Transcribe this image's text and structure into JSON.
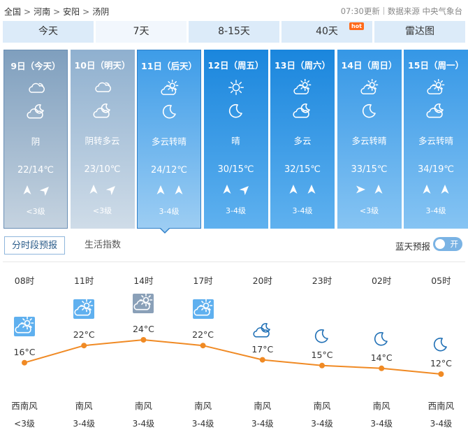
{
  "breadcrumb": [
    "全国",
    "河南",
    "安阳",
    "汤阴"
  ],
  "breadcrumb_sep": ">",
  "meta": {
    "update_time": "07:30更新",
    "source": "数据来源 中央气象台"
  },
  "tabs": [
    {
      "label": "今天"
    },
    {
      "label": "7天"
    },
    {
      "label": "8-15天"
    },
    {
      "label": "40天",
      "badge": "hot"
    },
    {
      "label": "雷达图"
    }
  ],
  "days": [
    {
      "date": "9日（今天）",
      "day_icon": "cloudy-icon",
      "night_icon": "cloudy-night-icon",
      "desc": "阴",
      "temp": "22/14℃",
      "winds": [
        "north",
        "northeast"
      ],
      "level": "<3级",
      "style": "past"
    },
    {
      "date": "10日（明天）",
      "day_icon": "cloudy-icon",
      "night_icon": "partly-cloudy-night-icon",
      "desc": "阴转多云",
      "temp": "23/10℃",
      "winds": [
        "north",
        "northeast"
      ],
      "level": "<3级",
      "style": "past2"
    },
    {
      "date": "11日（后天）",
      "day_icon": "partly-cloudy-day-icon",
      "night_icon": "moon-icon",
      "desc": "多云转晴",
      "temp": "24/12℃",
      "winds": [
        "north",
        "north"
      ],
      "level": "3-4级",
      "style": "sel"
    },
    {
      "date": "12日（周五）",
      "day_icon": "sun-icon",
      "night_icon": "moon-icon",
      "desc": "晴",
      "temp": "30/15℃",
      "winds": [
        "north",
        "northeast"
      ],
      "level": "3-4级",
      "style": "fut"
    },
    {
      "date": "13日（周六）",
      "day_icon": "partly-cloudy-day-icon",
      "night_icon": "partly-cloudy-night-icon",
      "desc": "多云",
      "temp": "32/15℃",
      "winds": [
        "north",
        "north"
      ],
      "level": "3-4级",
      "style": "fut"
    },
    {
      "date": "14日（周日）",
      "day_icon": "partly-cloudy-day-icon",
      "night_icon": "moon-icon",
      "desc": "多云转晴",
      "temp": "33/15℃",
      "winds": [
        "east",
        "north"
      ],
      "level": "<3级",
      "style": "fut2"
    },
    {
      "date": "15日（周一）",
      "day_icon": "partly-cloudy-day-icon",
      "night_icon": "partly-cloudy-night-icon",
      "desc": "多云转晴",
      "temp": "34/19℃",
      "winds": [
        "north",
        "north"
      ],
      "level": "3-4级",
      "style": "fut2"
    }
  ],
  "subtabs": {
    "active": "分时段预报",
    "other": "生活指数"
  },
  "blue_sky": {
    "label": "蓝天预报",
    "toggle": "开"
  },
  "hourly": [
    {
      "time": "08时",
      "icon": "partly-cloudy-day-icon",
      "temp": "16°C",
      "wind": "西南风",
      "level": "<3级"
    },
    {
      "time": "11时",
      "icon": "partly-cloudy-day-icon",
      "temp": "22°C",
      "wind": "南风",
      "level": "3-4级"
    },
    {
      "time": "14时",
      "icon": "partly-cloudy-day-gray-icon",
      "temp": "24°C",
      "wind": "南风",
      "level": "3-4级"
    },
    {
      "time": "17时",
      "icon": "partly-cloudy-day-icon",
      "temp": "22°C",
      "wind": "南风",
      "level": "3-4级"
    },
    {
      "time": "20时",
      "icon": "cloudy-night-icon",
      "temp": "17°C",
      "wind": "南风",
      "level": "3-4级"
    },
    {
      "time": "23时",
      "icon": "moon-icon",
      "temp": "15°C",
      "wind": "南风",
      "level": "3-4级"
    },
    {
      "time": "02时",
      "icon": "moon-icon",
      "temp": "14°C",
      "wind": "南风",
      "level": "3-4级"
    },
    {
      "time": "05时",
      "icon": "moon-icon",
      "temp": "12°C",
      "wind": "西南风",
      "level": "3-4级"
    }
  ],
  "chart_data": {
    "type": "line",
    "x": [
      "08时",
      "11时",
      "14时",
      "17时",
      "20时",
      "23时",
      "02时",
      "05时"
    ],
    "series": [
      {
        "values": [
          16,
          22,
          24,
          22,
          17,
          15,
          14,
          12
        ]
      }
    ]
  },
  "colors": {
    "line": "#f08a24",
    "accent": "#2e7fc8",
    "icon_blue": "#1f6fb5"
  }
}
